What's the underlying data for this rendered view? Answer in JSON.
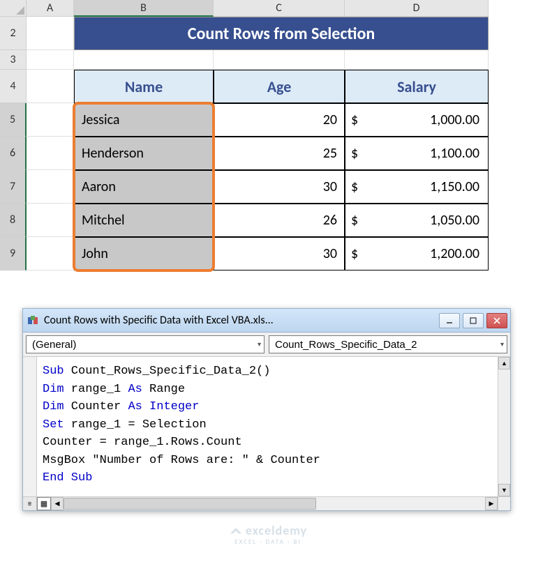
{
  "columns": {
    "A": "A",
    "B": "B",
    "C": "C",
    "D": "D"
  },
  "rows": {
    "r2": "2",
    "r3": "3",
    "r4": "4",
    "r5": "5",
    "r6": "6",
    "r7": "7",
    "r8": "8",
    "r9": "9"
  },
  "title": "Count Rows from Selection",
  "headers": {
    "name": "Name",
    "age": "Age",
    "salary": "Salary"
  },
  "data": [
    {
      "name": "Jessica",
      "age": "20",
      "cur": "$",
      "sal": "1,000.00"
    },
    {
      "name": "Henderson",
      "age": "25",
      "cur": "$",
      "sal": "1,100.00"
    },
    {
      "name": "Aaron",
      "age": "30",
      "cur": "$",
      "sal": "1,150.00"
    },
    {
      "name": "Mitchel",
      "age": "26",
      "cur": "$",
      "sal": "1,050.00"
    },
    {
      "name": "John",
      "age": "30",
      "cur": "$",
      "sal": "1,200.00"
    }
  ],
  "vba": {
    "title": "Count Rows with Specific Data with Excel VBA.xls...",
    "dd_left": "(General)",
    "dd_right": "Count_Rows_Specific_Data_2",
    "code": {
      "l1a": "Sub",
      "l1b": " Count_Rows_Specific_Data_2()",
      "l2a": "Dim",
      "l2b": " range_1 ",
      "l2c": "As",
      "l2d": " Range",
      "l3a": "Dim",
      "l3b": " Counter ",
      "l3c": "As Integer",
      "l4a": "Set",
      "l4b": " range_1 = Selection",
      "l5": "Counter = range_1.Rows.Count",
      "l6": "MsgBox \"Number of Rows are: \" & Counter",
      "l7": "End Sub"
    }
  },
  "watermark": {
    "brand": "exceldemy",
    "tag": "EXCEL · DATA · BI"
  }
}
